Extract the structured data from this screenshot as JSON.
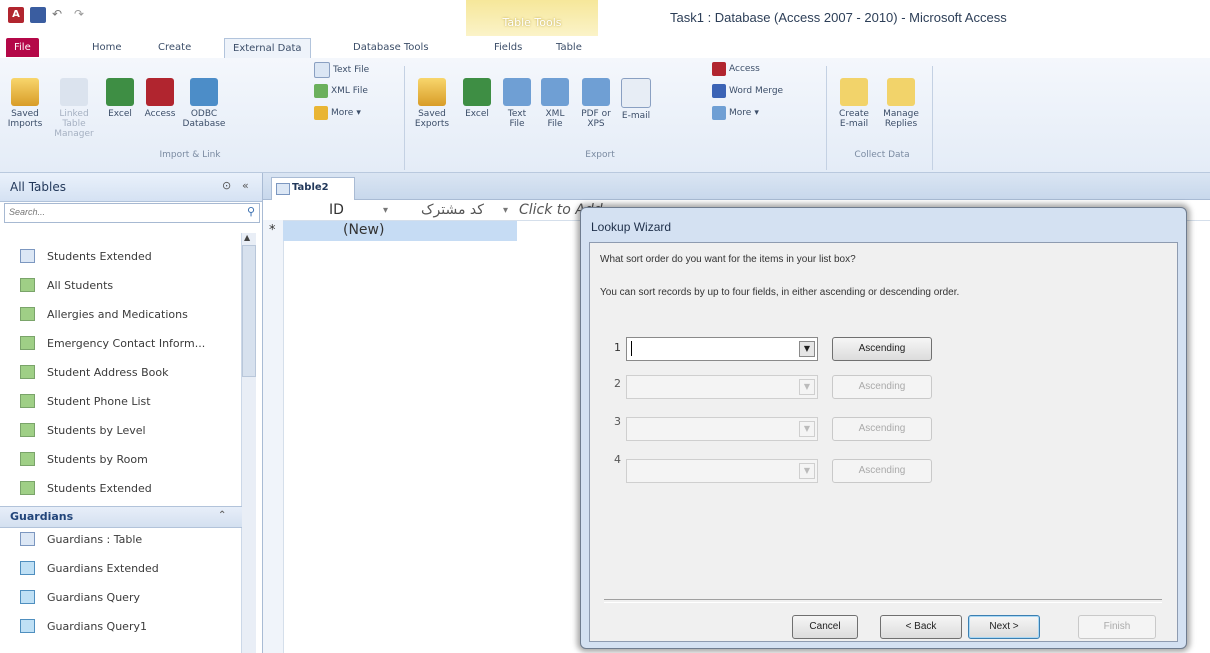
{
  "window": {
    "title": "Task1 : Database (Access 2007 - 2010)  -  Microsoft Access",
    "contextual_tab_group": "Table Tools"
  },
  "tabs": [
    "File",
    "Home",
    "Create",
    "External Data",
    "Database Tools",
    "Fields",
    "Table"
  ],
  "ribbon": {
    "import_group": {
      "label": "Import & Link",
      "saved_imports": "Saved Imports",
      "linked_table_manager": "Linked Table Manager",
      "excel": "Excel",
      "access": "Access",
      "odbc": "ODBC Database",
      "text_file": "Text File",
      "xml_file": "XML File",
      "more": "More"
    },
    "export_group": {
      "label": "Export",
      "saved_exports": "Saved Exports",
      "excel": "Excel",
      "text_file": "Text File",
      "xml_file": "XML File",
      "pdf": "PDF or XPS",
      "email": "E-mail",
      "access": "Access",
      "word_merge": "Word Merge",
      "more": "More"
    },
    "collect_group": {
      "label": "Collect Data",
      "create_email": "Create E-mail",
      "manage_replies": "Manage Replies"
    }
  },
  "nav": {
    "header": "All Tables",
    "search_placeholder": "Search...",
    "items": [
      {
        "label": "Students Extended",
        "type": "form"
      },
      {
        "label": "All Students",
        "type": "report"
      },
      {
        "label": "Allergies and Medications",
        "type": "report"
      },
      {
        "label": "Emergency Contact Inform...",
        "type": "report"
      },
      {
        "label": "Student Address Book",
        "type": "report"
      },
      {
        "label": "Student Phone List",
        "type": "report"
      },
      {
        "label": "Students by Level",
        "type": "report"
      },
      {
        "label": "Students by Room",
        "type": "report"
      },
      {
        "label": "Students Extended",
        "type": "report"
      }
    ],
    "group2": {
      "label": "Guardians",
      "items": [
        {
          "label": "Guardians : Table",
          "type": "table"
        },
        {
          "label": "Guardians Extended",
          "type": "query"
        },
        {
          "label": "Guardians Query",
          "type": "query"
        },
        {
          "label": "Guardians Query1",
          "type": "query"
        }
      ]
    }
  },
  "document": {
    "tab_label": "Table2",
    "columns": [
      "ID",
      "کد مشترک",
      "Click to Add"
    ],
    "new_row_label": "(New)",
    "row_marker": "*"
  },
  "dialog": {
    "title": "Lookup Wizard",
    "question": "What sort order do you want for the items in your list box?",
    "hint": "You can sort records by up to four fields, in either ascending or descending order.",
    "sorts": [
      {
        "num": "1",
        "value": "",
        "button": "Ascending",
        "enabled": true
      },
      {
        "num": "2",
        "value": "",
        "button": "Ascending",
        "enabled": false
      },
      {
        "num": "3",
        "value": "",
        "button": "Ascending",
        "enabled": false
      },
      {
        "num": "4",
        "value": "",
        "button": "Ascending",
        "enabled": false
      }
    ],
    "buttons": {
      "cancel": "Cancel",
      "back": "< Back",
      "next": "Next >",
      "finish": "Finish"
    }
  }
}
